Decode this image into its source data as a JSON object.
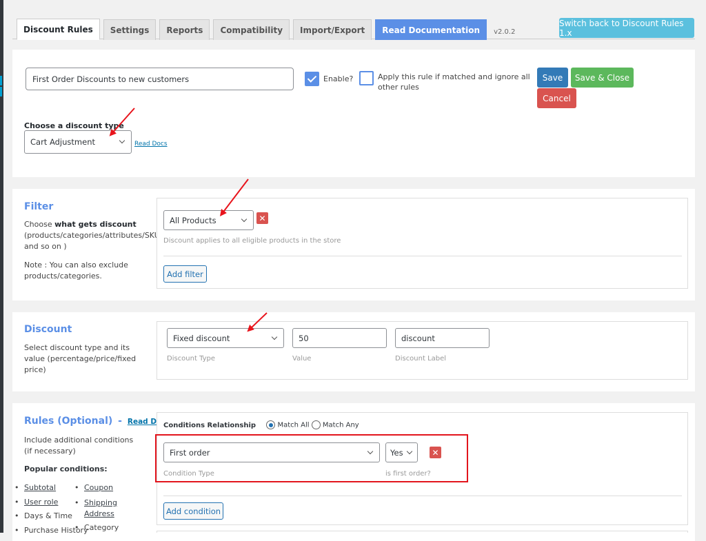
{
  "tabs": [
    {
      "label": "Discount Rules",
      "active": true
    },
    {
      "label": "Settings"
    },
    {
      "label": "Reports"
    },
    {
      "label": "Compatibility"
    },
    {
      "label": "Import/Export"
    },
    {
      "label": "Read Documentation"
    }
  ],
  "version": "v2.0.2",
  "switch_back_label": "Switch back to Discount Rules 1.x",
  "rule": {
    "name_value": "First Order Discounts to new customers",
    "enable_label": "Enable?",
    "enable_checked": true,
    "apply_label": "Apply this rule if matched and ignore all other rules",
    "apply_checked": false,
    "save_label": "Save",
    "save_close_label": "Save & Close",
    "cancel_label": "Cancel",
    "discount_type_label": "Choose a discount type",
    "discount_type_value": "Cart Adjustment",
    "read_docs": "Read Docs"
  },
  "filter": {
    "title": "Filter",
    "desc_prefix": "Choose ",
    "desc_bold": "what gets discount",
    "desc_rest": "(products/categories/attributes/SKU and so on )",
    "note": "Note : You can also exclude products/categories.",
    "select_value": "All Products",
    "hint": "Discount applies to all eligible products in the store",
    "add_label": "Add filter",
    "remove_icon": "close-icon"
  },
  "discount": {
    "title": "Discount",
    "desc": "Select discount type and its value (percentage/price/fixed price)",
    "type_value": "Fixed discount",
    "type_caption": "Discount Type",
    "value": "50",
    "value_caption": "Value",
    "label_value": "discount",
    "label_caption": "Discount Label"
  },
  "rules": {
    "title": "Rules (Optional)",
    "dash": "-",
    "read_docs": "Read Docs",
    "desc": "Include additional conditions (if necessary)",
    "popular_heading": "Popular conditions:",
    "popular": {
      "subtotal": "Subtotal",
      "user_role": "User role",
      "days_time": "Days & Time",
      "purchase_history": "Purchase History",
      "coupon": "Coupon",
      "shipping_address": "Shipping Address",
      "category": "Category"
    },
    "relationship_label": "Conditions Relationship",
    "match_all": "Match All",
    "match_any": "Match Any",
    "match_selected": "all",
    "condition_type_value": "First order",
    "condition_type_caption": "Condition Type",
    "condition_value": "Yes",
    "condition_value_caption": "is first order?",
    "add_condition_label": "Add condition"
  }
}
